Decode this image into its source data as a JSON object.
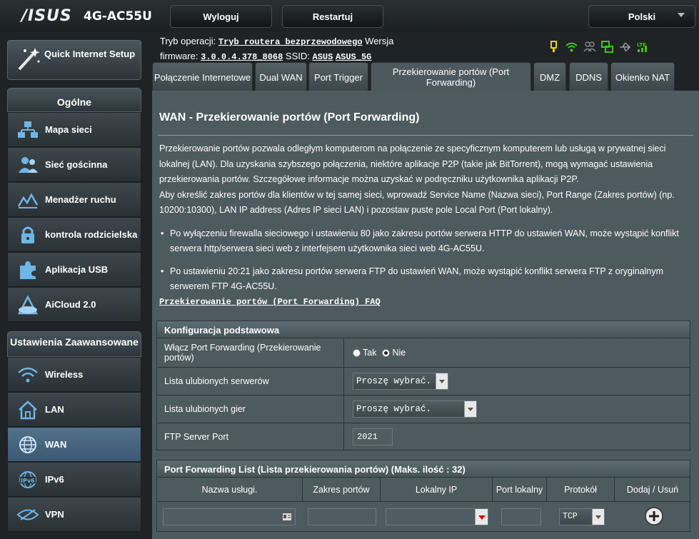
{
  "header": {
    "logo": "/ISUS",
    "model": "4G-AC55U",
    "logout_label": "Wyloguj",
    "restart_label": "Restartuj",
    "language": "Polski"
  },
  "info": {
    "mode_label": "Tryb operacji:",
    "mode_value": "Tryb routera bezprzewodowego",
    "version_label": "Wersja",
    "firmware_label": "firmware:",
    "firmware_value": "3.0.0.4.378_8068",
    "ssid_label": "SSID:",
    "ssid1": "ASUS",
    "ssid2": "ASUS_5G"
  },
  "status_icons": [
    "usb-lte-icon",
    "wifi-icon",
    "users-icon",
    "network-icon",
    "usb-icon",
    "lte-signal-icon"
  ],
  "sidebar": {
    "qis_label": "Quick Internet Setup",
    "general_header": "Ogólne",
    "general_items": [
      {
        "label": "Mapa sieci",
        "icon": "network-map-icon"
      },
      {
        "label": "Sieć gościnna",
        "icon": "guest-network-icon"
      },
      {
        "label": "Menadżer ruchu",
        "icon": "traffic-manager-icon"
      },
      {
        "label": "kontrola rodzicielska",
        "icon": "lock-icon"
      },
      {
        "label": "Aplikacja USB",
        "icon": "puzzle-icon"
      },
      {
        "label": "AiCloud 2.0",
        "icon": "cloud-icon"
      }
    ],
    "advanced_header": "Ustawienia Zaawansowane",
    "advanced_items": [
      {
        "label": "Wireless",
        "icon": "wireless-icon"
      },
      {
        "label": "LAN",
        "icon": "home-icon"
      },
      {
        "label": "WAN",
        "icon": "globe-icon"
      },
      {
        "label": "IPv6",
        "icon": "ipv6-icon"
      },
      {
        "label": "VPN",
        "icon": "vpn-icon"
      }
    ]
  },
  "tabs": [
    {
      "label": "Połączenie Internetowe"
    },
    {
      "label": "Dual WAN"
    },
    {
      "label": "Port Trigger"
    },
    {
      "label": "Przekierowanie portów (Port Forwarding)"
    },
    {
      "label": "DMZ"
    },
    {
      "label": "DDNS"
    },
    {
      "label": "Okienko NAT"
    }
  ],
  "main": {
    "title": "WAN - Przekierowanie portów (Port Forwarding)",
    "desc1": "Przekierowanie portów pozwala odległym komputerom na połączenie ze specyficznym komputerem lub usługą w prywatnej sieci lokalnej (LAN). Dla uzyskania szybszego połączenia, niektóre aplikacje P2P (takie jak BitTorrent), mogą wymagać ustawienia przekierowania portów. Szczegółowe informacje można uzyskać w podręczniku użytkownika aplikacji P2P.",
    "desc2": "Aby określić zakres portów dla klientów w tej samej sieci, wprowadź Service Name (Nazwa sieci), Port Range (Zakres portów) (np. 10200:10300), LAN IP address (Adres IP sieci LAN) i pozostaw puste pole Local Port (Port lokalny).",
    "bullet1": "Po wyłączeniu firewalla sieciowego i ustawieniu 80 jako zakresu portów serwera HTTP do ustawień WAN, może wystąpić konflikt serwera http/serwera sieci web z interfejsem użytkownika sieci web 4G-AC55U.",
    "bullet2": "Po ustawieniu 20:21 jako zakresu portów serwera FTP do ustawień WAN, może wystąpić konflikt serwera FTP z oryginalnym serwerem FTP 4G-AC55U.",
    "faq": "Przekierowanie portów (Port Forwarding) FAQ"
  },
  "basic": {
    "header": "Konfiguracja podstawowa",
    "enable_label": "Włącz Port Forwarding (Przekierowanie portów)",
    "yes": "Tak",
    "no": "Nie",
    "fav_servers_label": "Lista ulubionych serwerów",
    "fav_servers_value": "Proszę wybrać.",
    "fav_games_label": "Lista ulubionych gier",
    "fav_games_value": "Proszę wybrać.",
    "ftp_label": "FTP Server Port",
    "ftp_value": "2021"
  },
  "list": {
    "header": "Port Forwarding List (Lista przekierowania portów) (Maks. ilość : 32)",
    "columns": [
      "Nazwa usługi.",
      "Zakres portów",
      "Lokalny IP",
      "Port lokalny",
      "Protokół",
      "Dodaj / Usuń"
    ],
    "protocol_value": "TCP"
  }
}
